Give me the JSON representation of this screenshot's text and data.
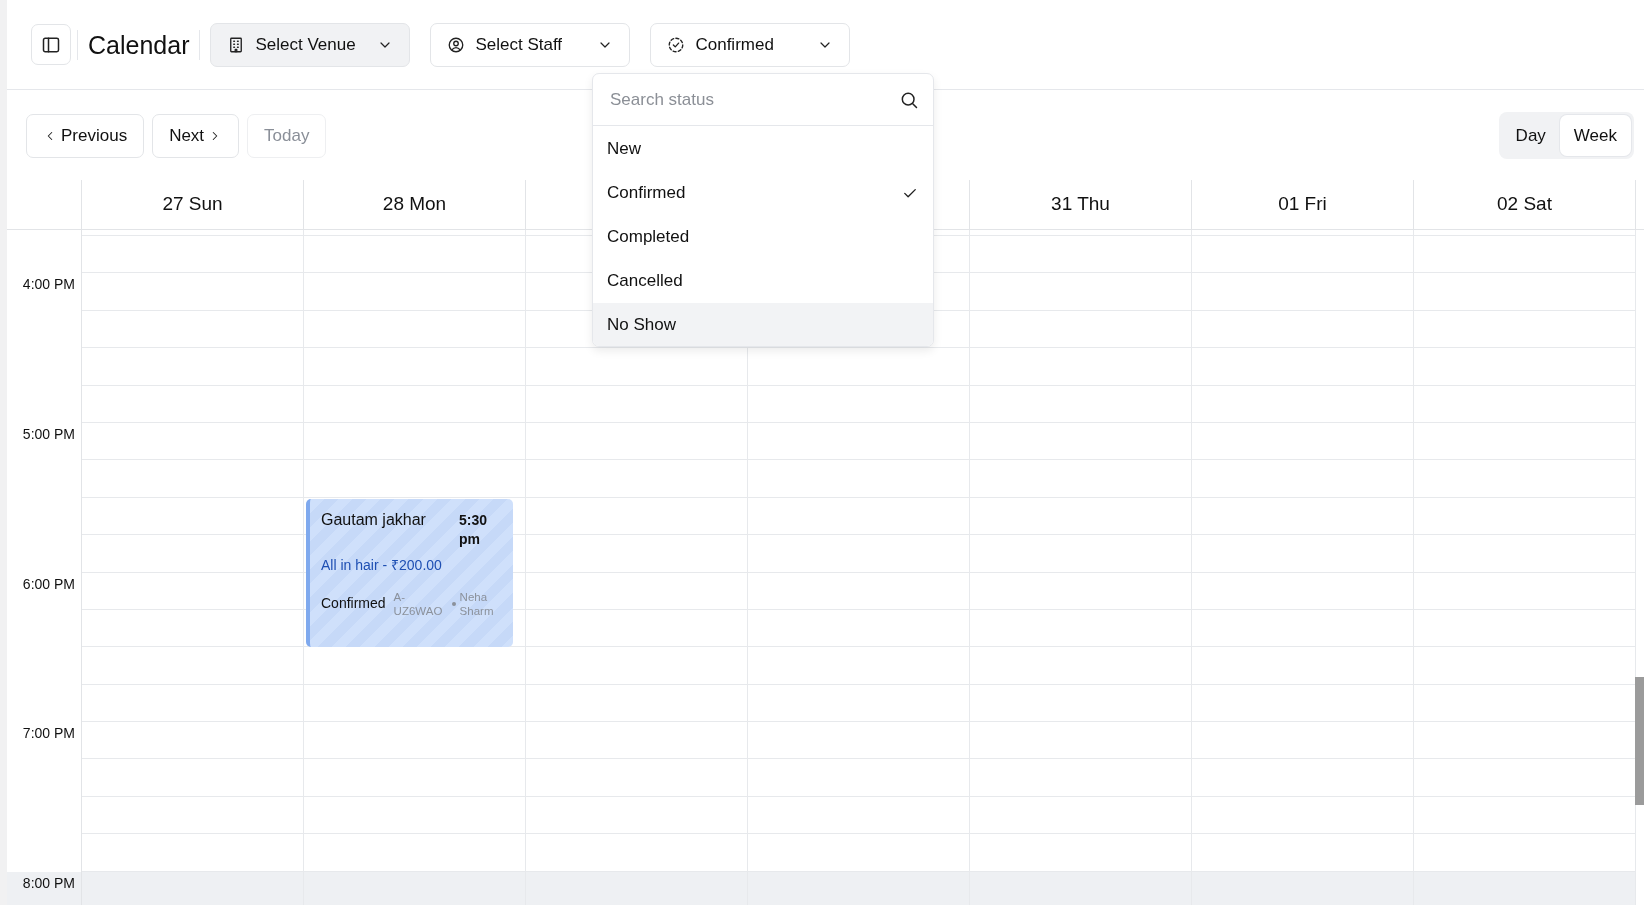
{
  "title": "Calendar",
  "filters": [
    {
      "kind": "venue",
      "label": "Select Venue",
      "highlighted": true
    },
    {
      "kind": "staff",
      "label": "Select Staff",
      "highlighted": false
    },
    {
      "kind": "status",
      "label": "Confirmed",
      "highlighted": false
    }
  ],
  "status_menu": {
    "placeholder": "Search status",
    "items": [
      {
        "label": "New",
        "selected": false,
        "highlighted": false
      },
      {
        "label": "Confirmed",
        "selected": true,
        "highlighted": false
      },
      {
        "label": "Completed",
        "selected": false,
        "highlighted": false
      },
      {
        "label": "Cancelled",
        "selected": false,
        "highlighted": false
      },
      {
        "label": "No Show",
        "selected": false,
        "highlighted": true
      }
    ]
  },
  "nav_buttons": [
    {
      "kind": "previous",
      "label": "Previous",
      "disabled": false
    },
    {
      "kind": "next",
      "label": "Next",
      "disabled": false
    },
    {
      "kind": "today",
      "label": "Today",
      "disabled": true
    }
  ],
  "views": [
    {
      "label": "Day",
      "selected": false
    },
    {
      "label": "Week",
      "selected": true
    }
  ],
  "days": [
    {
      "label": "27 Sun"
    },
    {
      "label": "28 Mon",
      "events": [
        {
          "name": "Gautam jakhar",
          "time": "5:30 pm",
          "service": "All in hair - ₹200.00",
          "status": "Confirmed",
          "code": "A-UZ6WAO",
          "staff": "Neha Sharm"
        }
      ]
    },
    {
      "covered": true
    },
    {
      "covered": true
    },
    {
      "label": "31 Thu"
    },
    {
      "label": "01 Fri"
    },
    {
      "label": "02 Sat"
    }
  ],
  "hours": [
    {
      "label": "4:00 PM",
      "shaded": false
    },
    {
      "label": "5:00 PM",
      "shaded": false
    },
    {
      "label": "6:00 PM",
      "shaded": false
    },
    {
      "label": "7:00 PM",
      "shaded": false
    },
    {
      "label": "8:00 PM",
      "shaded": true
    }
  ]
}
